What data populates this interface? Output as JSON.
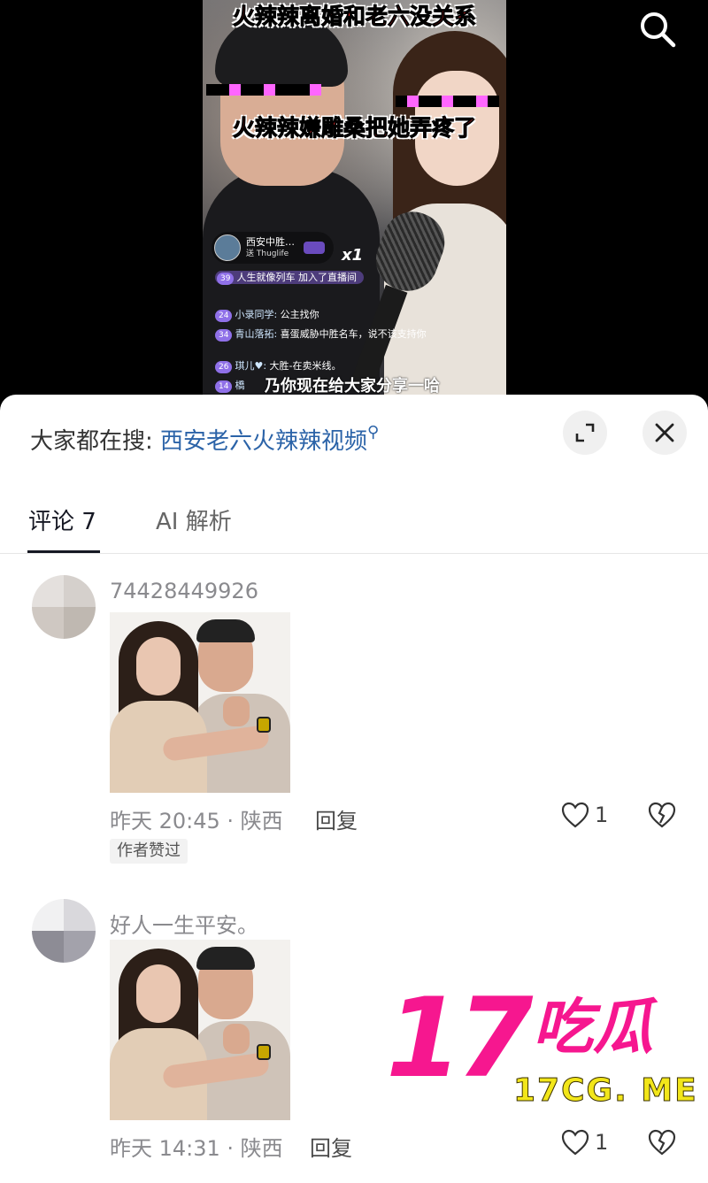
{
  "video": {
    "caption_top": "火辣辣离婚和老六没关系",
    "caption_mid": "火辣辣嫌雕桑把她弄疼了",
    "gift": {
      "user": "西安中胜…",
      "sub": "送 Thuglife",
      "count": "x1"
    },
    "chat": [
      {
        "level": "39",
        "name": "人生就像列车",
        "text": "加入了直播间"
      },
      {
        "level": "24",
        "name": "小录同学:",
        "text": "公主找你"
      },
      {
        "level": "34",
        "name": "青山落拓:",
        "text": "喜蛋威胁中胜名车，说不该支持你"
      },
      {
        "level": "26",
        "name": "琪儿♥:",
        "text": "大胜-在卖米线。"
      },
      {
        "level": "14",
        "name": "橋",
        "text": ""
      }
    ],
    "share_line": "乃你现在给大家分享一哈"
  },
  "sheet": {
    "search_prefix": "大家都在搜:",
    "search_keyword": "西安老六火辣辣视频",
    "tabs": [
      {
        "label": "评论 7",
        "active": true
      },
      {
        "label": "AI 解析",
        "active": false
      }
    ]
  },
  "comments": [
    {
      "username": "74428449926",
      "time_loc": "昨天 20:45 · 陕西",
      "reply_label": "回复",
      "likes": "1",
      "author_liked": "作者赞过"
    },
    {
      "username": "好人一生平安。",
      "time_loc": "昨天 14:31 · 陕西",
      "reply_label": "回复",
      "likes": "1"
    }
  ],
  "watermark": {
    "number": "17",
    "name": "吃瓜",
    "url": "17CG. ME"
  },
  "colors": {
    "accent_link": "#2b63a8",
    "watermark_pink": "#f6178f",
    "watermark_yellow": "#f2e61a",
    "caption_red": "#ff2a2a"
  },
  "icons": [
    "search-icon",
    "expand-icon",
    "close-icon",
    "heart-icon",
    "broken-heart-icon"
  ]
}
